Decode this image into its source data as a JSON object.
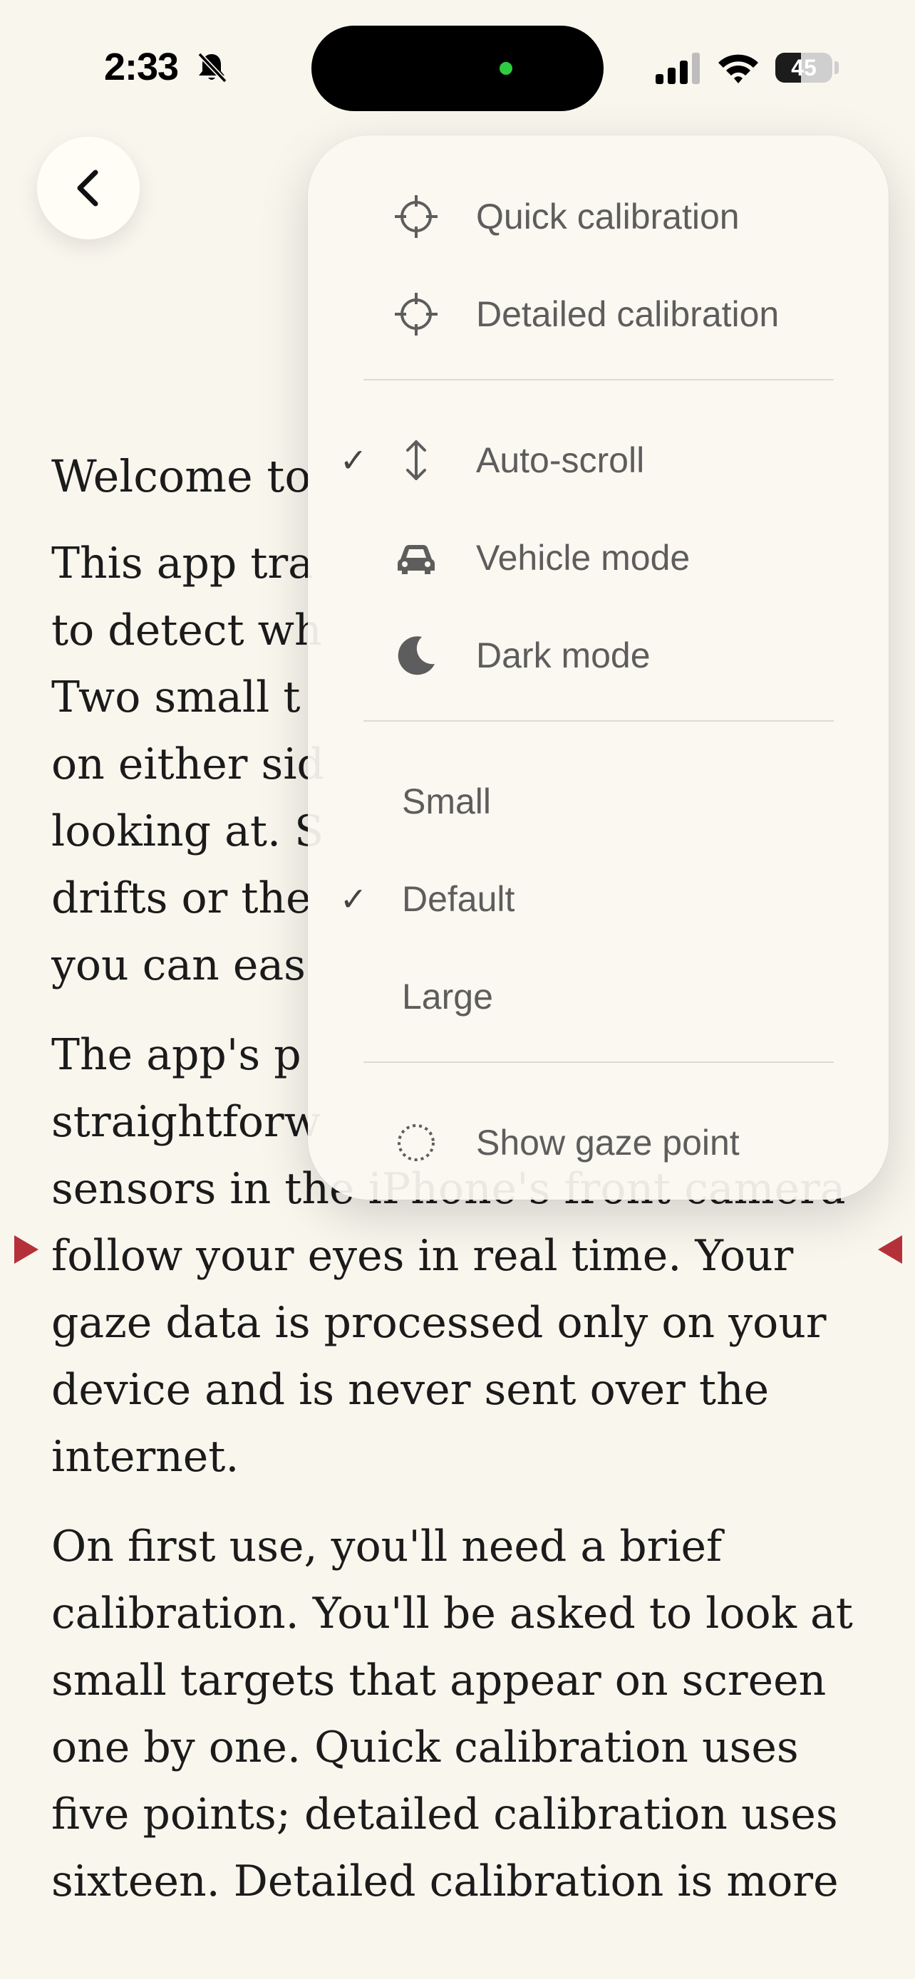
{
  "status_bar": {
    "time": "2:33",
    "battery": "45",
    "battery_level": 0.45
  },
  "article": {
    "heading": "Welcome to",
    "paragraphs": [
      "This app tra\nto detect wh\nTwo small t\non either sid\nlooking at. S\ndrifts or the\nyou can eas",
      "The app's p\nstraightforw\nsensors in the iPhone's front camera follow your eyes in real time. Your gaze data is processed only on your device and is never sent over the internet.",
      "On first use, you'll need a brief calibration. You'll be asked to look at small targets that appear on screen one by one. Quick calibration uses five points; detailed calibration uses sixteen. Detailed calibration is more"
    ]
  },
  "menu": {
    "calibration": [
      {
        "label": "Quick calibration",
        "icon": "crosshair-icon"
      },
      {
        "label": "Detailed calibration",
        "icon": "crosshair-icon"
      }
    ],
    "modes": [
      {
        "label": "Auto-scroll",
        "icon": "vertical-arrows-icon",
        "checked": true,
        "check": "✓"
      },
      {
        "label": "Vehicle mode",
        "icon": "car-icon",
        "checked": false,
        "check": ""
      },
      {
        "label": "Dark mode",
        "icon": "moon-icon",
        "checked": false,
        "check": ""
      }
    ],
    "sizes": [
      {
        "label": "Small",
        "checked": false,
        "check": ""
      },
      {
        "label": "Default",
        "checked": true,
        "check": "✓"
      },
      {
        "label": "Large",
        "checked": false,
        "check": ""
      }
    ],
    "gaze": {
      "label": "Show gaze point",
      "icon": "dotted-circle-icon"
    }
  },
  "colors": {
    "background": "#f9f6ee",
    "menu_background": "#faf8f0",
    "menu_text": "#5d5d5d",
    "marker": "#b5313a",
    "status_green": "#2ecc40"
  }
}
